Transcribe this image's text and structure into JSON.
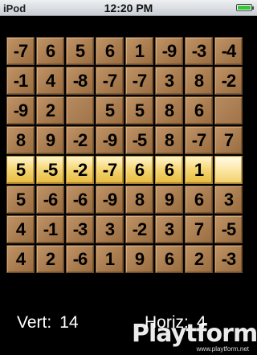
{
  "status_bar": {
    "carrier": "iPod",
    "time": "12:20 PM",
    "battery_level": 1.0,
    "battery_color": "#33c53b"
  },
  "board": {
    "rows": [
      [
        "-7",
        "6",
        "5",
        "6",
        "1",
        "-9",
        "-3",
        "-4"
      ],
      [
        "-1",
        "4",
        "-8",
        "-7",
        "-7",
        "3",
        "8",
        "-2"
      ],
      [
        "-9",
        "2",
        "",
        "5",
        "5",
        "8",
        "6",
        ""
      ],
      [
        "8",
        "9",
        "-2",
        "-9",
        "-5",
        "8",
        "-7",
        "7"
      ],
      [
        "5",
        "-5",
        "-2",
        "-7",
        "6",
        "6",
        "1",
        ""
      ],
      [
        "5",
        "-6",
        "-6",
        "-9",
        "8",
        "9",
        "6",
        "3"
      ],
      [
        "4",
        "-1",
        "-3",
        "3",
        "-2",
        "3",
        "7",
        "-5"
      ],
      [
        "4",
        "2",
        "-6",
        "1",
        "9",
        "6",
        "2",
        "-3"
      ]
    ],
    "active_row": 4,
    "tile_color": "#a97d4f",
    "highlight_color": "#f6d879"
  },
  "scores": {
    "vert_label": "Vert:",
    "vert_value": "14",
    "horiz_label": "Horiz:",
    "horiz_value": "4"
  },
  "watermark": {
    "logo": "Playtform",
    "url": "www.playtform.net"
  }
}
